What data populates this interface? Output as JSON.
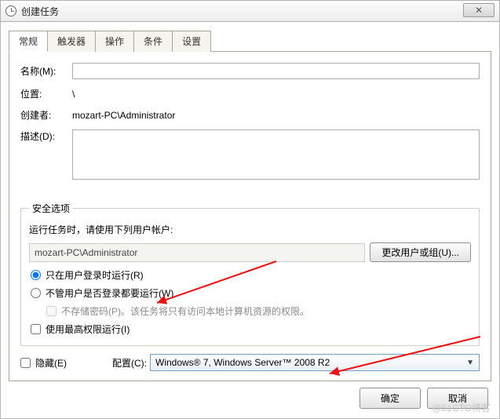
{
  "title": "创建任务",
  "tabs": {
    "general": "常规",
    "triggers": "触发器",
    "actions": "操作",
    "conditions": "条件",
    "settings": "设置"
  },
  "form": {
    "name_label": "名称(M):",
    "name_value": "",
    "location_label": "位置:",
    "location_value": "\\",
    "creator_label": "创建者:",
    "creator_value": "mozart-PC\\Administrator",
    "desc_label": "描述(D):"
  },
  "security": {
    "legend": "安全选项",
    "run_as_label": "运行任务时，请使用下列用户帐户:",
    "user": "mozart-PC\\Administrator",
    "change_user_btn": "更改用户或组(U)...",
    "radio_only": "只在用户登录时运行(R)",
    "radio_any": "不管用户是否登录都要运行(W)",
    "no_pwd": "不存储密码(P)。该任务将只有访问本地计算机资源的权限。",
    "highest": "使用最高权限运行(I)"
  },
  "bottom": {
    "hidden_label": "隐藏(E)",
    "config_label": "配置(C):",
    "config_value": "Windows® 7, Windows Server™ 2008 R2"
  },
  "dialog": {
    "ok": "确定",
    "cancel": "取消"
  },
  "watermark": "@51CTO博客"
}
